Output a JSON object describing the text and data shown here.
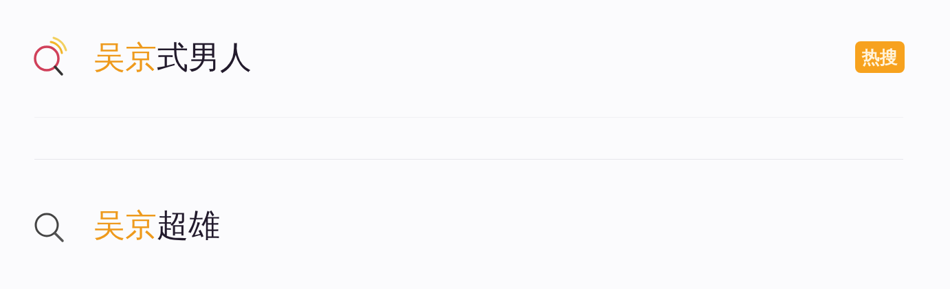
{
  "suggestions": [
    {
      "kind": "hot",
      "match": "吴京",
      "rest": "式男人",
      "badge": "热搜"
    },
    {
      "kind": "plain",
      "match": "吴京",
      "rest": "超雄"
    }
  ]
}
